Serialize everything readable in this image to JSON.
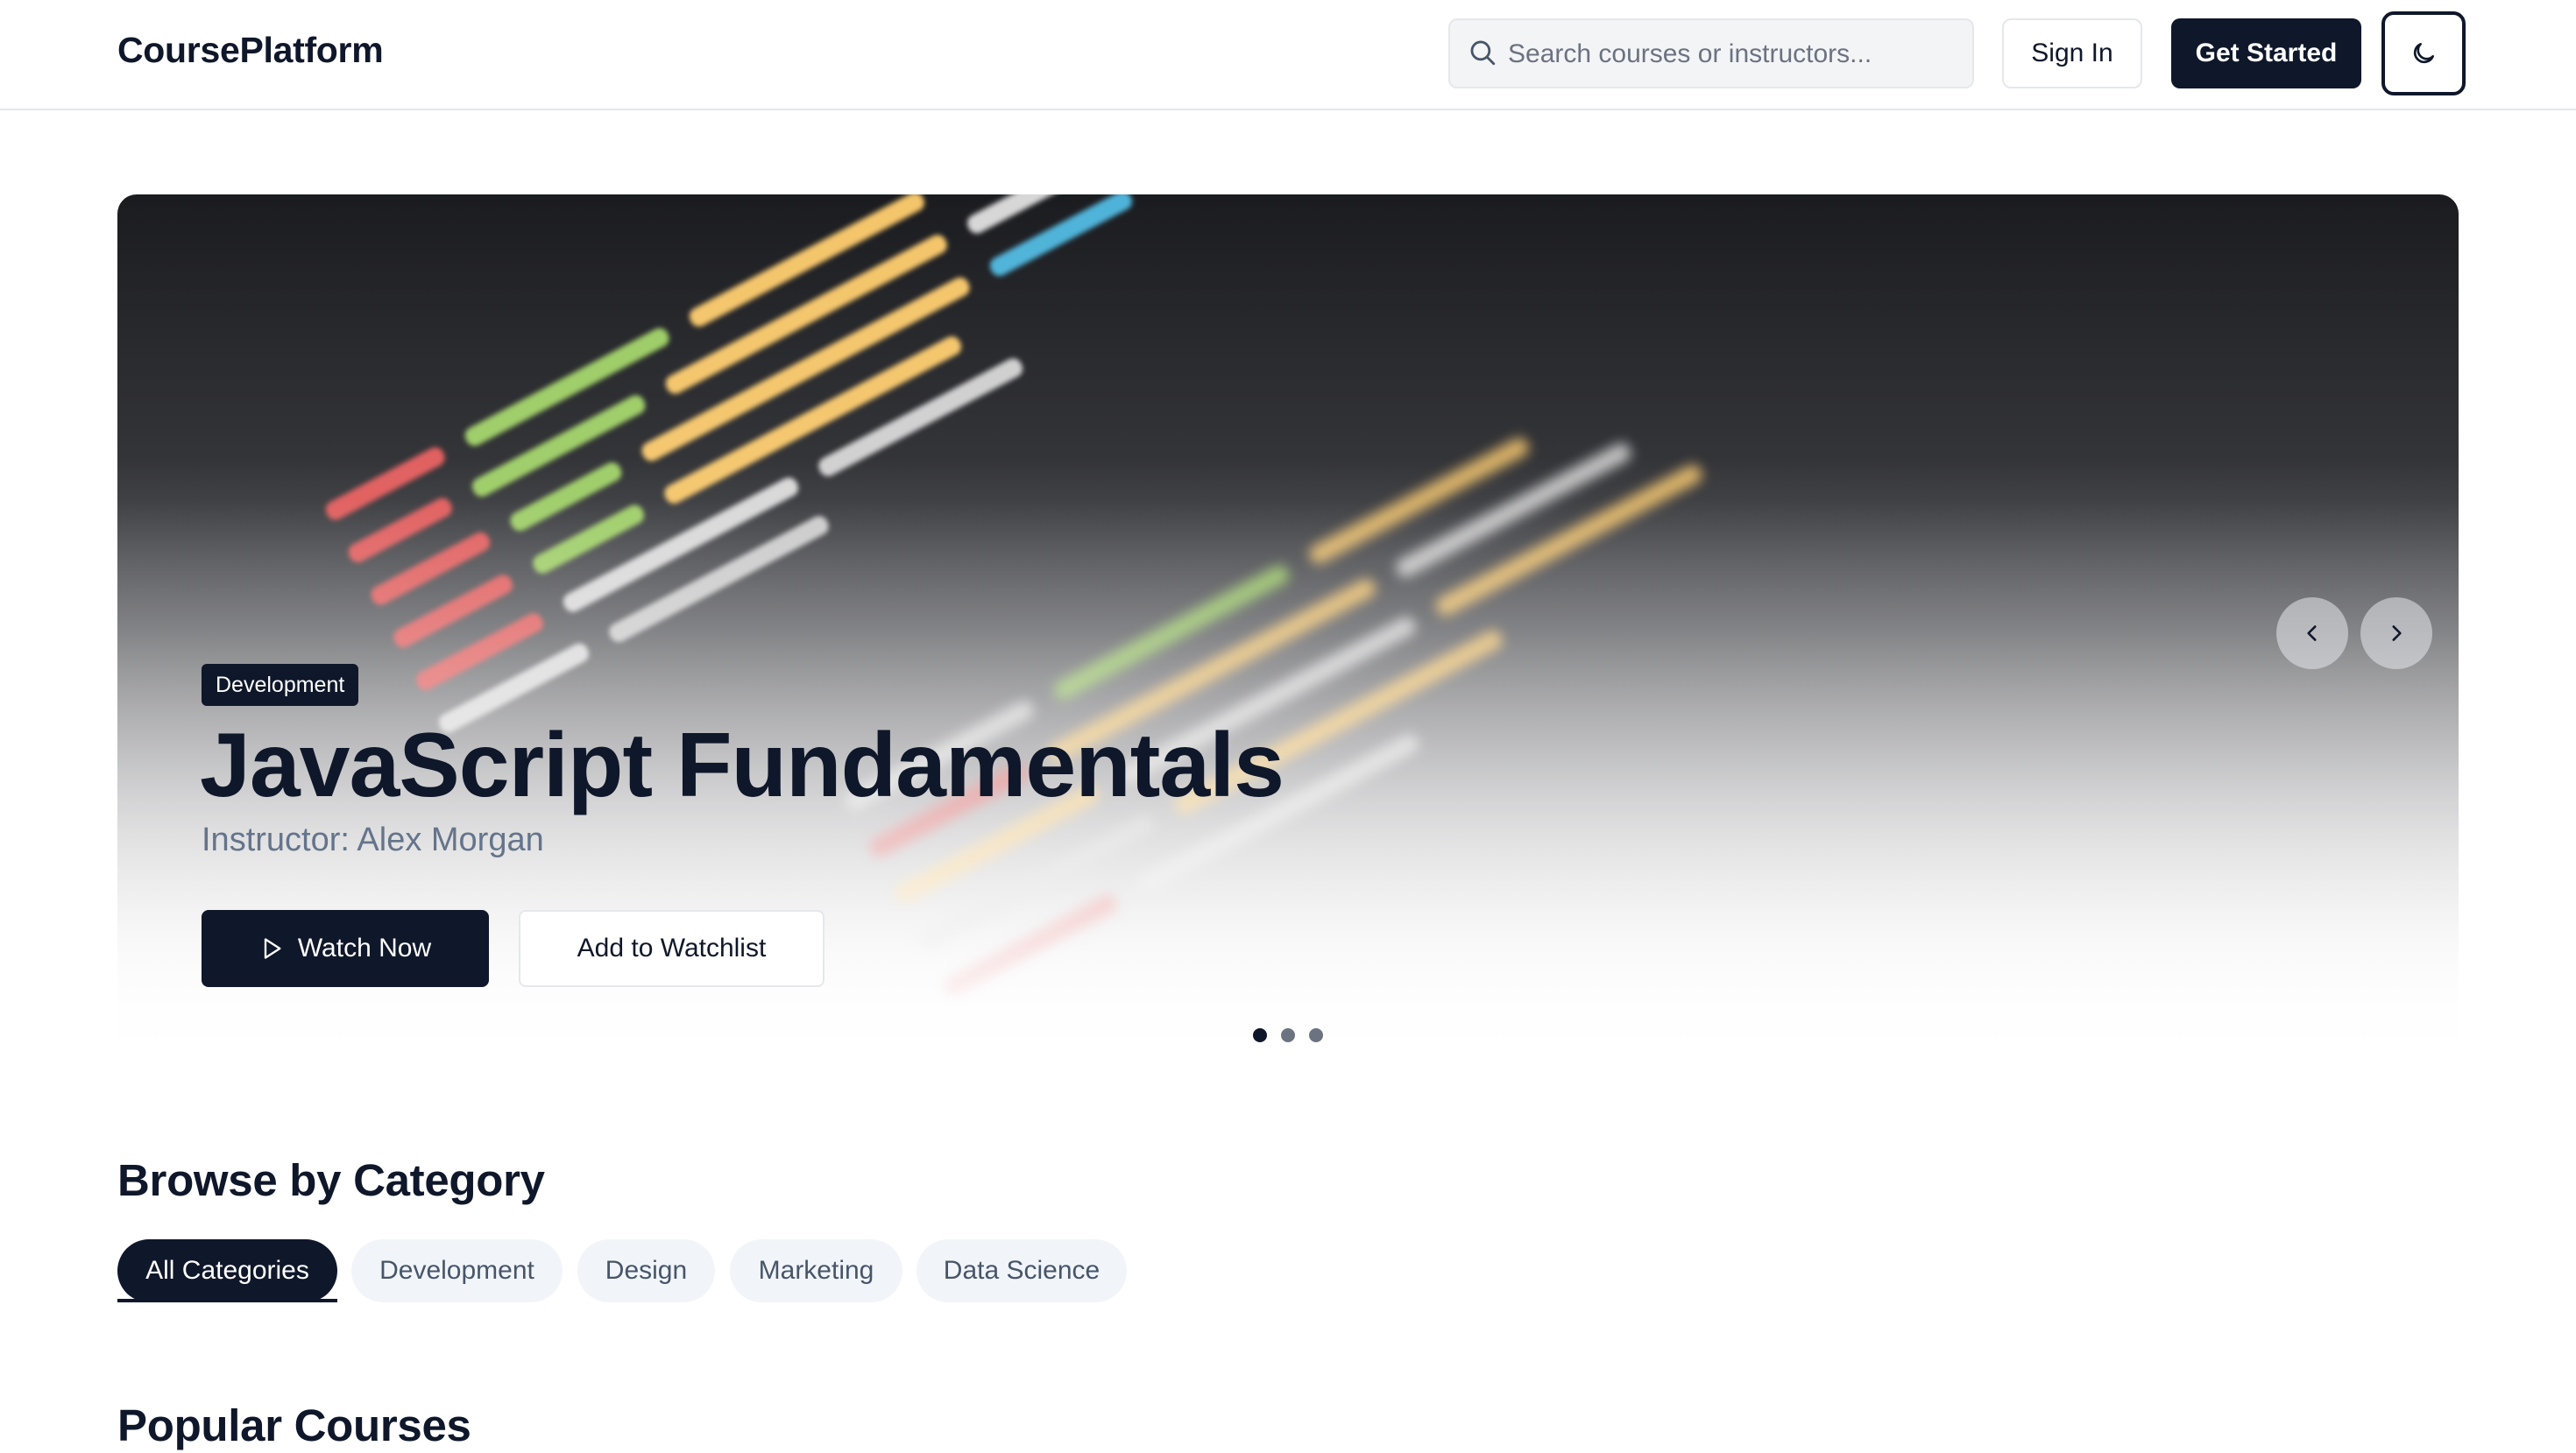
{
  "header": {
    "logo": "CoursePlatform",
    "search_placeholder": "Search courses or instructors...",
    "signin_label": "Sign In",
    "get_started_label": "Get Started",
    "theme_icon": "moon-icon"
  },
  "hero": {
    "badge": "Development",
    "title": "JavaScript Fundamentals",
    "instructor": "Instructor: Alex Morgan",
    "watch_label": "Watch Now",
    "watchlist_label": "Add to Watchlist",
    "slide_count": 3,
    "active_slide": 1
  },
  "categories": {
    "title": "Browse by Category",
    "items": [
      "All Categories",
      "Development",
      "Design",
      "Marketing",
      "Data Science"
    ],
    "active": "All Categories"
  },
  "popular": {
    "title": "Popular Courses"
  },
  "colors": {
    "primary": "#0f172a",
    "chip_bg": "#f1f5f9",
    "muted_text": "#64748b",
    "border": "#e5e7eb"
  }
}
